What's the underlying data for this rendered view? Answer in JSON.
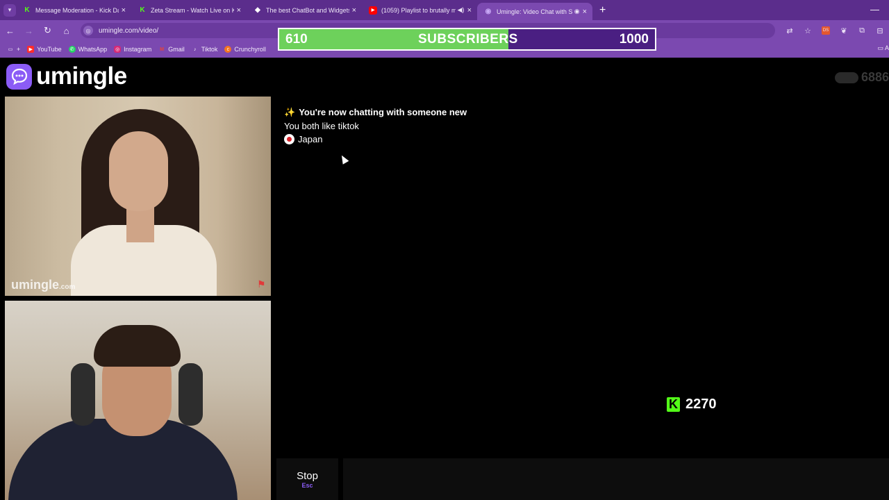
{
  "browser": {
    "tabs": [
      {
        "title": "Message Moderation - Kick Da",
        "favicon": "kick-icon"
      },
      {
        "title": "Zeta Stream - Watch Live on Ki",
        "favicon": "kick-icon"
      },
      {
        "title": "The best ChatBot and Widgets",
        "favicon": "diamond-icon"
      },
      {
        "title": "(1059) Playlist to brutally m",
        "favicon": "youtube-icon"
      },
      {
        "title": "Umingle: Video Chat with S",
        "favicon": "umingle-icon"
      }
    ],
    "url": "umingle.com/video/",
    "bookmarks": [
      "YouTube",
      "WhatsApp",
      "Instagram",
      "Gmail",
      "Tiktok",
      "Crunchyroll"
    ],
    "bookmarks_right": "A"
  },
  "subs_overlay": {
    "current": "610",
    "label": "SUBSCRIBERS",
    "goal": "1000",
    "progress_fraction": 0.61
  },
  "header": {
    "logo_text": "umingle",
    "online_count": "6886"
  },
  "videos": {
    "stranger_watermark": "umingle",
    "stranger_watermark_suffix": ".com"
  },
  "chat": {
    "intro": "You're now chatting with someone new",
    "interest": "You both like tiktok",
    "country": "Japan"
  },
  "kick_counter": {
    "value": "2270"
  },
  "controls": {
    "stop_label": "Stop",
    "stop_key": "Esc",
    "message_placeholder": ""
  },
  "colors": {
    "accent": "#8b5cf6",
    "browser_chrome": "#7b49b0",
    "subs_fill": "#6dd15b",
    "kick_green": "#53fc18"
  }
}
